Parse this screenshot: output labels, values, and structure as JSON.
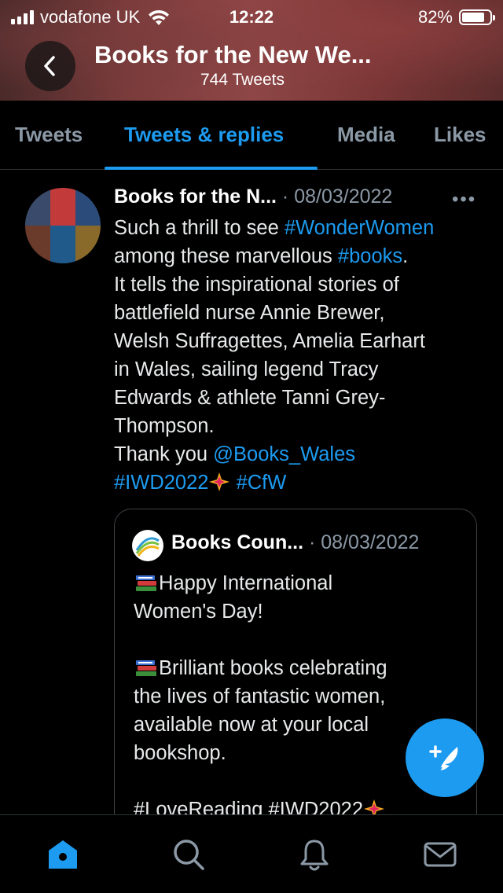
{
  "status_bar": {
    "carrier": "vodafone UK",
    "time": "12:22",
    "battery": "82%",
    "battery_level": 0.82
  },
  "header": {
    "title": "Books for the New We...",
    "tweet_count": "744 Tweets"
  },
  "tabs": [
    {
      "label": "Tweets",
      "active": false
    },
    {
      "label": "Tweets & replies",
      "active": true
    },
    {
      "label": "Media",
      "active": false
    },
    {
      "label": "Likes",
      "active": false
    }
  ],
  "tweet": {
    "author": "Books for the N...",
    "separator": " · ",
    "date": "08/03/2022",
    "text": {
      "l1_a": "Such a thrill to see ",
      "l1_link": "#WonderWomen",
      "l2_a": "among these marvellous ",
      "l2_link": "#books",
      "l2_b": ".",
      "l3": "It tells the inspirational stories of",
      "l4": "battlefield nurse Annie Brewer,",
      "l5": "Welsh Suffragettes, Amelia Earhart",
      "l6": "in Wales, sailing legend Tracy",
      "l7": "Edwards & athlete Tanni Grey-",
      "l8": "Thompson.",
      "l9_a": "Thank you ",
      "l9_link": "@Books_Wales",
      "l10_link1": "#IWD2022",
      "l10_link2": "#CfW"
    },
    "quoted": {
      "author": "Books Coun...",
      "separator": " · ",
      "date": "08/03/2022",
      "l1": "Happy International",
      "l2": "Women's Day!",
      "l3": "Brilliant books celebrating",
      "l4": "the lives of fantastic women,",
      "l5": "available now at your local",
      "l6": "bookshop.",
      "l7": "#LoveReading #IWD2022"
    }
  },
  "icons": {
    "back": "chevron-left-icon",
    "more": "more-horizontal-icon",
    "compose": "compose-tweet-icon",
    "nav": [
      "home-icon",
      "search-icon",
      "notifications-icon",
      "messages-icon"
    ]
  },
  "colors": {
    "accent": "#1d9bf0",
    "background": "#000000",
    "muted_text": "#8b98a5"
  }
}
